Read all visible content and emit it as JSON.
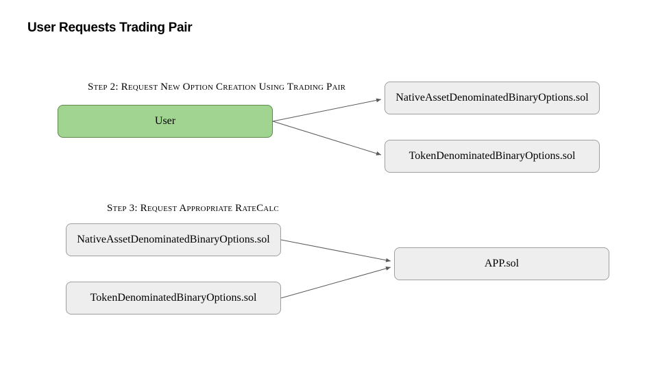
{
  "title": "User Requests Trading Pair",
  "step2": {
    "label": "Step 2: Request New Option Creation Using Trading Pair",
    "user": "User",
    "native": "NativeAssetDenominatedBinaryOptions.sol",
    "token": "TokenDenominatedBinaryOptions.sol"
  },
  "step3": {
    "label": "Step 3: Request  Appropriate RateCalc",
    "native": "NativeAssetDenominatedBinaryOptions.sol",
    "token": "TokenDenominatedBinaryOptions.sol",
    "app": "APP.sol"
  },
  "colors": {
    "greyFill": "#eeeeee",
    "greyStroke": "#9e9e9e",
    "greenFill": "#a1d490",
    "greenStroke": "#5a8a4a",
    "arrow": "#595959"
  }
}
